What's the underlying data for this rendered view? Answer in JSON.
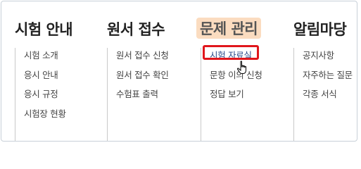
{
  "menu": {
    "columns": [
      {
        "title": "시험 안내",
        "items": [
          "시험 소개",
          "응시 안내",
          "응시 규정",
          "시험장 현황"
        ]
      },
      {
        "title": "원서 접수",
        "items": [
          "원서 접수 신청",
          "원서 접수 확인",
          "수험표 출력"
        ]
      },
      {
        "title": "문제 관리",
        "items": [
          "시험 자료실",
          "문항 이의 신청",
          "정답 보기"
        ]
      },
      {
        "title": "알림마당",
        "items": [
          "공지사항",
          "자주하는 질문",
          "각종 서식"
        ]
      }
    ]
  },
  "colors": {
    "active_header_bg": "#fbdcc0",
    "highlight_border": "#e0161c",
    "link_color": "#2a4a8a"
  },
  "icons": [
    "hand-pointer-cursor-icon"
  ]
}
